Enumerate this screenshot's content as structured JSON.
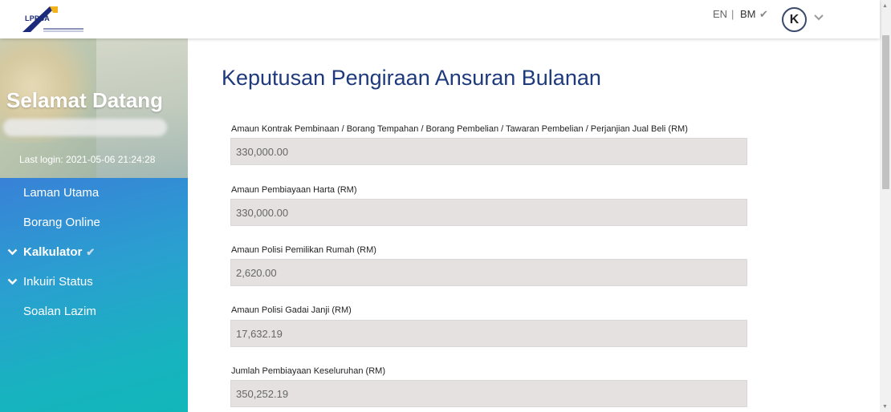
{
  "header": {
    "logo_text": "LPPSA",
    "lang_en": "EN",
    "lang_separator": "|",
    "lang_bm": "BM",
    "avatar_initial": "K"
  },
  "sidebar": {
    "welcome": "Selamat Datang",
    "last_login": "Last login: 2021-05-06 21:24:28",
    "items": [
      {
        "label": "Laman Utama"
      },
      {
        "label": "Borang Online"
      },
      {
        "label": "Kalkulator"
      },
      {
        "label": "Inkuiri Status"
      },
      {
        "label": "Soalan Lazim"
      }
    ]
  },
  "main": {
    "title": "Keputusan Pengiraan Ansuran Bulanan",
    "fields": [
      {
        "label": "Amaun Kontrak Pembinaan / Borang Tempahan / Borang Pembelian / Tawaran Pembelian / Perjanjian Jual Beli (RM)",
        "value": "330,000.00"
      },
      {
        "label": "Amaun Pembiayaan Harta (RM)",
        "value": "330,000.00"
      },
      {
        "label": "Amaun Polisi Pemilikan Rumah (RM)",
        "value": "2,620.00"
      },
      {
        "label": "Amaun Polisi Gadai Janji (RM)",
        "value": "17,632.19"
      },
      {
        "label": "Jumlah Pembiayaan Keseluruhan (RM)",
        "value": "350,252.19"
      }
    ]
  },
  "colors": {
    "title_blue": "#1e3a7c",
    "sidebar_top": "#2c6fd0",
    "sidebar_bottom": "#12b7b9",
    "field_bg": "#e6e1e1"
  }
}
